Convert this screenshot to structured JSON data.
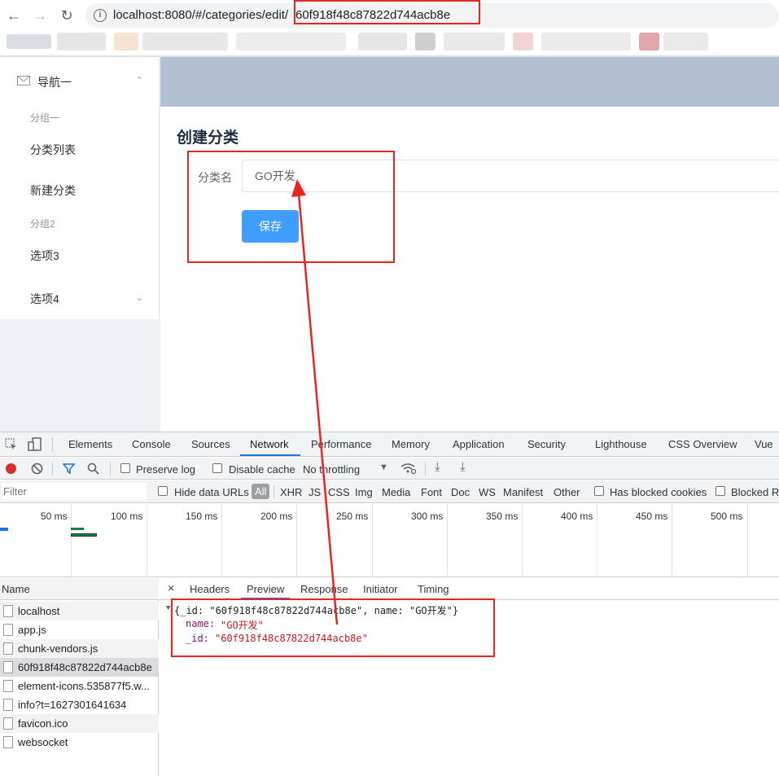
{
  "browser": {
    "url_host": "localhost:8080/#/categories/edit/",
    "url_id": "60f918f48c87822d744acb8e"
  },
  "sidebar": {
    "menu_title": "导航一",
    "group1": "分组一",
    "items": [
      "分类列表",
      "新建分类"
    ],
    "group2": "分组2",
    "option3": "选项3",
    "option4": "选项4"
  },
  "main": {
    "title": "创建分类",
    "field_label": "分类名",
    "field_value": "GO开发",
    "save_label": "保存"
  },
  "devtools": {
    "tabs": [
      "Elements",
      "Console",
      "Sources",
      "Network",
      "Performance",
      "Memory",
      "Application",
      "Security",
      "Lighthouse",
      "CSS Overview",
      "Vue"
    ],
    "active_tab": "Network",
    "toolbar": {
      "preserve_log": "Preserve log",
      "disable_cache": "Disable cache",
      "throttling": "No throttling"
    },
    "filter": {
      "placeholder": "Filter",
      "hide_data_urls": "Hide data URLs",
      "types": [
        "All",
        "XHR",
        "JS",
        "CSS",
        "Img",
        "Media",
        "Font",
        "Doc",
        "WS",
        "Manifest",
        "Other"
      ],
      "has_blocked_cookies": "Has blocked cookies",
      "blocked_requests": "Blocked Re"
    },
    "timeline_ticks": [
      "50 ms",
      "100 ms",
      "150 ms",
      "200 ms",
      "250 ms",
      "300 ms",
      "350 ms",
      "400 ms",
      "450 ms",
      "500 ms"
    ],
    "name_header": "Name",
    "requests": [
      "localhost",
      "app.js",
      "chunk-vendors.js",
      "60f918f48c87822d744acb8e",
      "element-icons.535877f5.w...",
      "info?t=1627301641634",
      "favicon.ico",
      "websocket"
    ],
    "detail_tabs": [
      "Headers",
      "Preview",
      "Response",
      "Initiator",
      "Timing"
    ],
    "preview": {
      "summary": "{_id: \"60f918f48c87822d744acb8e\", name: \"GO开发\"}",
      "name_key": "name:",
      "name_val": "\"GO开发\"",
      "id_key": "_id:",
      "id_val": "\"60f918f48c87822d744acb8e\""
    }
  },
  "colors": {
    "annotation_red": "#e8261f",
    "primary_blue": "#409eff",
    "header_bg": "#b3c0d1"
  }
}
